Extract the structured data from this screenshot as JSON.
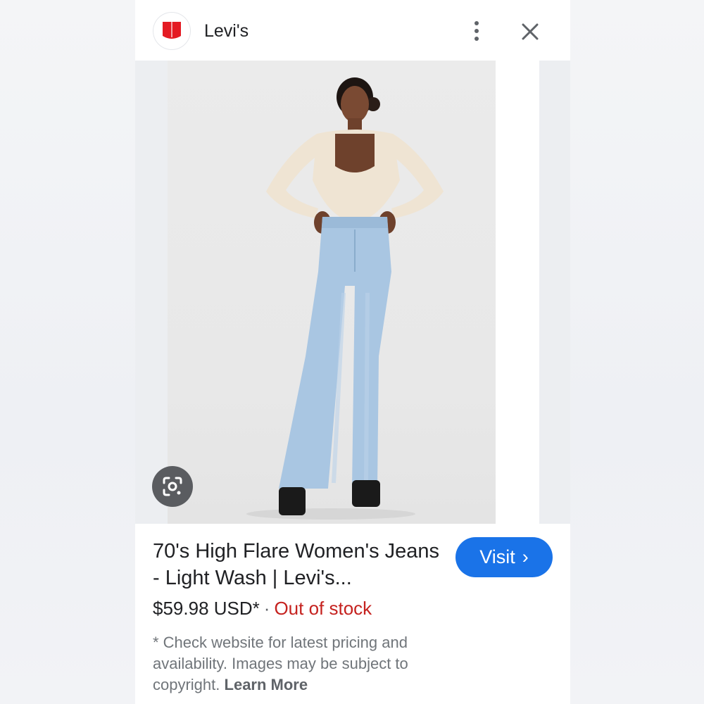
{
  "header": {
    "source_name": "Levi's",
    "logo_icon": "levis-logo-icon",
    "brand_color": "#e41b23",
    "more_icon": "more-vert-icon",
    "close_icon": "close-icon"
  },
  "image": {
    "lens_icon": "google-lens-icon"
  },
  "product": {
    "title": "70's High Flare Women's Jeans - Light Wash | Levi's...",
    "price": "$59.98 USD*",
    "separator": "·",
    "stock_status": "Out of stock",
    "stock_color": "#c5221f"
  },
  "visit_button": {
    "label": "Visit",
    "chevron": "›",
    "color": "#1a73e8"
  },
  "disclaimer": {
    "text": "* Check website for latest pricing and availability. Images may be subject to copyright.",
    "link": "Learn More"
  }
}
